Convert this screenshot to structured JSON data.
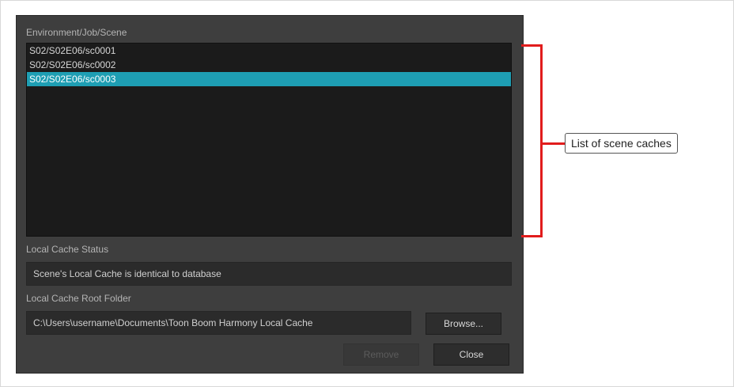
{
  "dialog": {
    "scene_list_label": "Environment/Job/Scene",
    "scenes": [
      {
        "path": "S02/S02E06/sc0001",
        "selected": false
      },
      {
        "path": "S02/S02E06/sc0002",
        "selected": false
      },
      {
        "path": "S02/S02E06/sc0003",
        "selected": true
      }
    ],
    "cache_status_label": "Local Cache Status",
    "cache_status_value": "Scene's Local Cache is identical to database",
    "root_folder_label": "Local Cache Root Folder",
    "root_folder_value": "C:\\Users\\username\\Documents\\Toon Boom Harmony Local Cache",
    "browse_label": "Browse...",
    "remove_label": "Remove",
    "close_label": "Close"
  },
  "annotation": {
    "callout_text": "List of scene caches",
    "accent_color": "#e11c1c"
  },
  "colors": {
    "dialog_bg": "#3e3e3e",
    "list_bg": "#1b1b1b",
    "selection": "#1e9eb3"
  }
}
